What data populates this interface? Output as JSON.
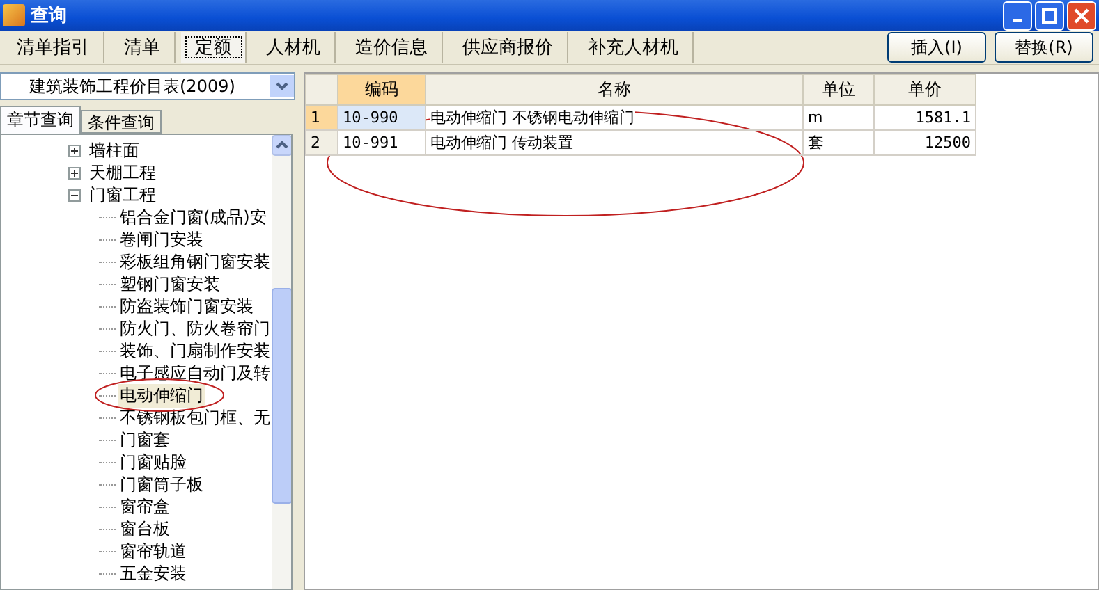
{
  "window": {
    "title": "查询"
  },
  "tabs": [
    {
      "label": "清单指引",
      "selected": false
    },
    {
      "label": "清单",
      "selected": false
    },
    {
      "label": "定额",
      "selected": true
    },
    {
      "label": "人材机",
      "selected": false
    },
    {
      "label": "造价信息",
      "selected": false
    },
    {
      "label": "供应商报价",
      "selected": false
    },
    {
      "label": "补充人材机",
      "selected": false
    }
  ],
  "buttons": [
    "插入(I)",
    "替换(R)"
  ],
  "library": {
    "value": "建筑装饰工程价目表(2009)"
  },
  "query_tabs": [
    {
      "label": "章节查询",
      "selected": true
    },
    {
      "label": "条件查询",
      "selected": false
    }
  ],
  "tree": [
    {
      "label": "墙柱面",
      "expanded": false
    },
    {
      "label": "天棚工程",
      "expanded": false
    },
    {
      "label": "门窗工程",
      "expanded": true,
      "children": [
        {
          "label": "铝合金门窗(成品)安",
          "selected": false
        },
        {
          "label": "卷闸门安装",
          "selected": false
        },
        {
          "label": "彩板组角钢门窗安装",
          "selected": false
        },
        {
          "label": "塑钢门窗安装",
          "selected": false
        },
        {
          "label": "防盗装饰门窗安装",
          "selected": false
        },
        {
          "label": "防火门、防火卷帘门",
          "selected": false
        },
        {
          "label": "装饰、门扇制作安装",
          "selected": false
        },
        {
          "label": "电子感应自动门及转",
          "selected": false
        },
        {
          "label": "电动伸缩门",
          "selected": true
        },
        {
          "label": "不锈钢板包门框、无",
          "selected": false
        },
        {
          "label": "门窗套",
          "selected": false
        },
        {
          "label": "门窗贴脸",
          "selected": false
        },
        {
          "label": "门窗筒子板",
          "selected": false
        },
        {
          "label": "窗帘盒",
          "selected": false
        },
        {
          "label": "窗台板",
          "selected": false
        },
        {
          "label": "窗帘轨道",
          "selected": false
        },
        {
          "label": "五金安装",
          "selected": false
        }
      ]
    }
  ],
  "table": {
    "columns": [
      "编码",
      "名称",
      "单位",
      "单价"
    ],
    "rows": [
      {
        "index": "1",
        "code": "10-990",
        "name": "电动伸缩门 不锈钢电动伸缩门",
        "unit": "m",
        "price": "1581.1",
        "selected": true
      },
      {
        "index": "2",
        "code": "10-991",
        "name": "电动伸缩门 传动装置",
        "unit": "套",
        "price": "12500",
        "selected": false
      }
    ]
  }
}
